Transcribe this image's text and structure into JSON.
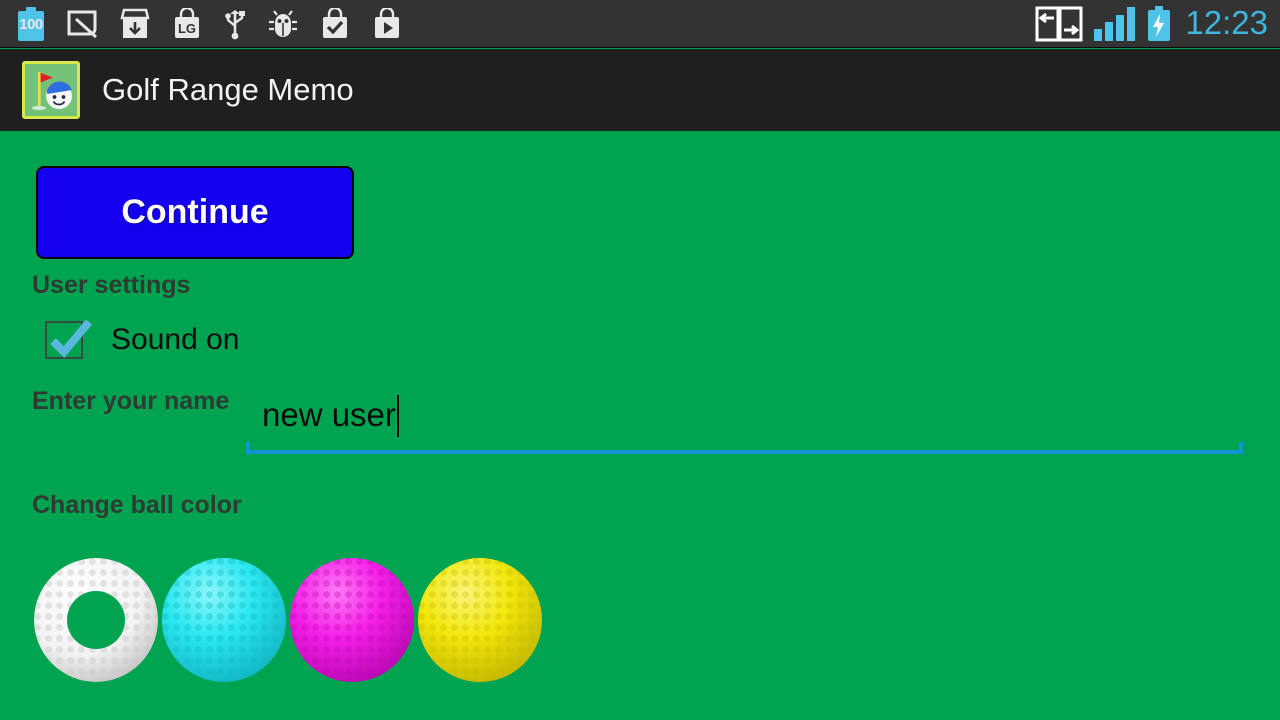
{
  "status_bar": {
    "background": "#333333",
    "battery_level_text": "100",
    "clock": "12:23",
    "clock_color": "#3FB6DE",
    "accent_color": "#4FC3E8",
    "left_icons": [
      {
        "name": "battery-100-icon",
        "label": "100"
      },
      {
        "name": "screenshot-icon",
        "label": ""
      },
      {
        "name": "download-box-icon",
        "label": ""
      },
      {
        "name": "lg-bag-icon",
        "label": "LG"
      },
      {
        "name": "usb-icon",
        "label": ""
      },
      {
        "name": "bug-icon",
        "label": ""
      },
      {
        "name": "check-bag-icon",
        "label": ""
      },
      {
        "name": "play-bag-icon",
        "label": ""
      }
    ],
    "right_icons": [
      {
        "name": "data-transfer-icon",
        "label": ""
      },
      {
        "name": "signal-bars-icon",
        "label": "",
        "bars_filled": 4,
        "bars_total": 4
      },
      {
        "name": "battery-charging-icon",
        "label": ""
      }
    ]
  },
  "title_bar": {
    "background": "#1F1F1F",
    "app_name": "Golf Range Memo",
    "icon_name": "golf-range-memo-app-icon"
  },
  "main": {
    "background_color": "#00A450",
    "continue_button": {
      "label": "Continue",
      "background": "#1400EE",
      "text_color": "#FFFFFF",
      "border_color": "#000000"
    },
    "user_settings_label": "User settings",
    "sound_checkbox": {
      "label": "Sound on",
      "checked": true,
      "check_color": "#5BB7DC",
      "border_color": "#3A4A40"
    },
    "enter_name_label": "Enter your name",
    "name_input": {
      "value": "new user",
      "placeholder": "Enter your name",
      "underline_color": "#1592D4",
      "caret_visible": true
    },
    "change_ball_color_label": "Change ball color",
    "balls": [
      {
        "name": "ball-white",
        "color": "#FFFFFF",
        "shade": "#C9C9C9",
        "selected": true
      },
      {
        "name": "ball-cyan",
        "color": "#2BE8F0",
        "shade": "#0FB9C6",
        "selected": false
      },
      {
        "name": "ball-magenta",
        "color": "#F520E8",
        "shade": "#C006B8",
        "selected": false
      },
      {
        "name": "ball-yellow",
        "color": "#F2E80C",
        "shade": "#C6BC00",
        "selected": false
      }
    ]
  }
}
